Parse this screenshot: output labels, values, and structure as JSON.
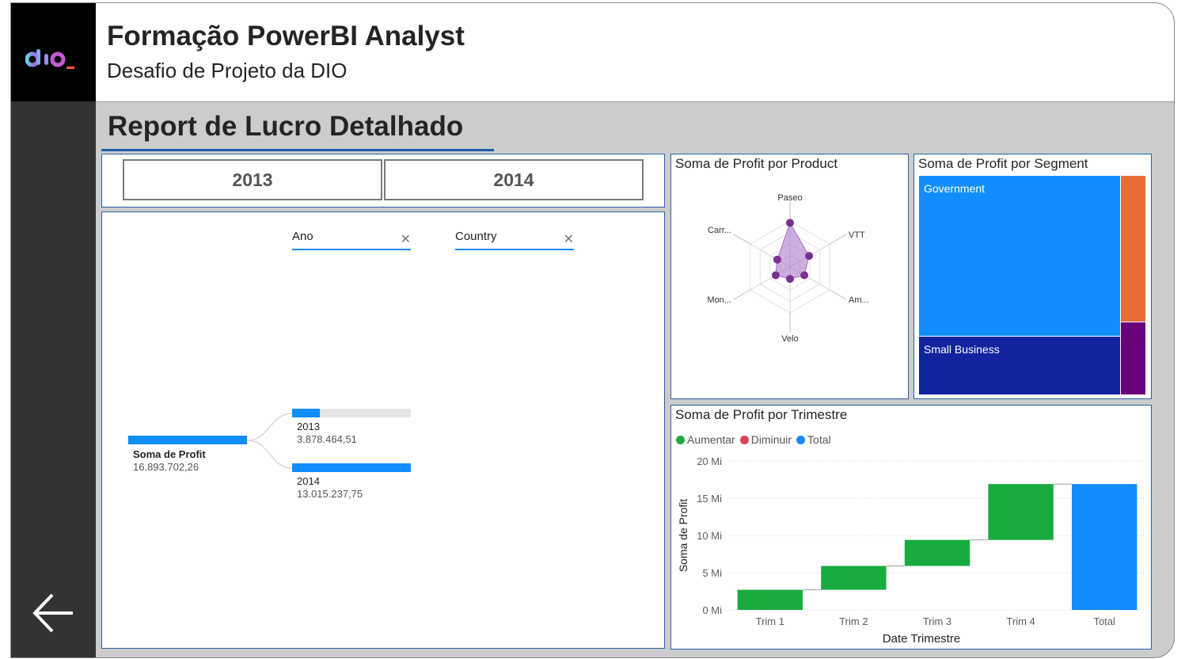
{
  "header": {
    "title": "Formação PowerBI Analyst",
    "subtitle": "Desafio de Projeto da DIO"
  },
  "report": {
    "title": "Report de Lucro Detalhado"
  },
  "year_slicer": {
    "buttons": [
      "2013",
      "2014"
    ]
  },
  "decomposition_tree": {
    "levels": [
      {
        "label": "Ano",
        "clear_icon": "close-icon"
      },
      {
        "label": "Country",
        "clear_icon": "close-icon"
      }
    ],
    "root": {
      "label": "Soma de Profit",
      "value": "16.893.702,26"
    },
    "children": [
      {
        "label": "2013",
        "value": "3.878.464,51",
        "fill": 0.23
      },
      {
        "label": "2014",
        "value": "13.015.237,75",
        "fill": 1.0
      }
    ]
  },
  "radar": {
    "title": "Soma de Profit por Product",
    "chart_data": {
      "type": "radar",
      "categories": [
        "Paseo",
        "VTT",
        "Am...",
        "Velo",
        "Mon...",
        "Carr..."
      ],
      "values": [
        4.8,
        2.4,
        1.8,
        1.3,
        1.8,
        1.6
      ],
      "rmax": 5,
      "color": "#a56fc6",
      "point_color": "#7a2f93"
    }
  },
  "treemap": {
    "title": "Soma de Profit por Segment",
    "segments": [
      {
        "label": "Government",
        "color": "#118dff"
      },
      {
        "label": "Small Business",
        "color": "#12239e"
      },
      {
        "label": "",
        "color": "#e66c37"
      },
      {
        "label": "",
        "color": "#6b007b"
      }
    ]
  },
  "waterfall": {
    "title": "Soma de Profit por Trimestre",
    "legend": [
      {
        "label": "Aumentar",
        "color": "#1aab40"
      },
      {
        "label": "Diminuir",
        "color": "#d64554"
      },
      {
        "label": "Total",
        "color": "#118dff"
      }
    ],
    "chart_data": {
      "type": "waterfall",
      "categories": [
        "Trim 1",
        "Trim 2",
        "Trim 3",
        "Trim 4",
        "Total"
      ],
      "values": [
        2.7,
        3.2,
        3.5,
        7.5,
        16.9
      ],
      "is_total": [
        false,
        false,
        false,
        false,
        true
      ],
      "ylim": [
        0,
        20
      ],
      "yticks": [
        0,
        5,
        10,
        15,
        20
      ],
      "ytick_labels": [
        "0 Mi",
        "5 Mi",
        "10 Mi",
        "15 Mi",
        "20 Mi"
      ],
      "xlabel": "Date Trimestre",
      "ylabel": "Soma de Profit",
      "grid": true
    }
  }
}
